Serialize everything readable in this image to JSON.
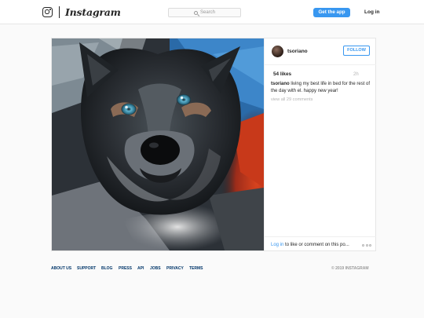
{
  "header": {
    "logo_icon": "instagram-camera-icon",
    "wordmark": "Instagram",
    "search": {
      "placeholder": "Search",
      "icon": "search-icon"
    },
    "get_app_label": "Get the app",
    "login_label": "Log in",
    "accent_color": "#3897f0"
  },
  "post": {
    "image_subject": "husky-dog-photo",
    "username": "tsoriano",
    "follow_label": "FOLLOW",
    "likes": "54 likes",
    "time_ago": "2h",
    "caption_username": "tsoriano",
    "caption_text": " living my best life in bed for the rest of the day with el. happy new year!",
    "view_all_comments": "view all 29 comments",
    "login_link": "Log in",
    "login_prompt": " to like or comment on this po...",
    "more_icon": "more-options-icon"
  },
  "footer": {
    "links": [
      "ABOUT US",
      "SUPPORT",
      "BLOG",
      "PRESS",
      "API",
      "JOBS",
      "PRIVACY",
      "TERMS"
    ],
    "copyright": "© 2019 INSTAGRAM",
    "link_color": "#003569"
  }
}
